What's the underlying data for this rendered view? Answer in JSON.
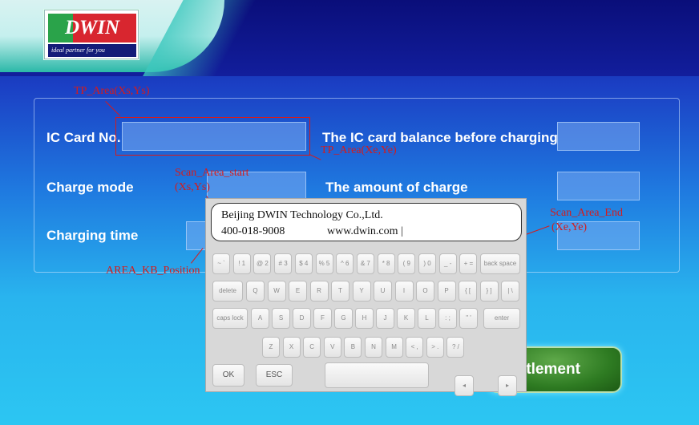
{
  "logo": {
    "brand": "DWIN",
    "tagline": "ideal partner for you"
  },
  "form": {
    "ic_card_label": "IC Card No.",
    "balance_label": "The IC card balance before charging",
    "charge_mode_label": "Charge mode",
    "amount_label": "The amount of charge",
    "charging_time_label": "Charging time"
  },
  "settlement_label": "ttlement",
  "annotations": {
    "tp_area_start": "TP_Area(Xs,Ys)",
    "tp_area_end": "TP_Area(Xe,Ye)",
    "scan_start_1": "Scan_Area_start",
    "scan_start_2": "(Xs,Ys)",
    "scan_end_1": "Scan_Area_End",
    "scan_end_2": "(Xe,Ye)",
    "kb_position": "AREA_KB_Position",
    "color": "#d61b1b"
  },
  "scan_text": {
    "line1": "Beijing DWIN Technology Co.,Ltd.",
    "line2_phone": "400-018-9008",
    "line2_web": "www.dwin.com |"
  },
  "keyboard": {
    "row1": [
      "~ `",
      "! 1",
      "@ 2",
      "# 3",
      "$ 4",
      "% 5",
      "^ 6",
      "& 7",
      "* 8",
      "( 9",
      ") 0",
      "_ -",
      "+ =",
      "back space"
    ],
    "row2": [
      "delete",
      "Q",
      "W",
      "E",
      "R",
      "T",
      "Y",
      "U",
      "I",
      "O",
      "P",
      "{ [",
      "} ]",
      "| \\"
    ],
    "row3": [
      "caps lock",
      "A",
      "S",
      "D",
      "F",
      "G",
      "H",
      "J",
      "K",
      "L",
      ": ;",
      "\" '",
      "enter"
    ],
    "row4": [
      "Z",
      "X",
      "C",
      "V",
      "B",
      "N",
      "M",
      "< ,",
      "> .",
      "? /"
    ],
    "ok": "OK",
    "esc": "ESC",
    "left_arrow": "◂",
    "right_arrow": "▸"
  }
}
